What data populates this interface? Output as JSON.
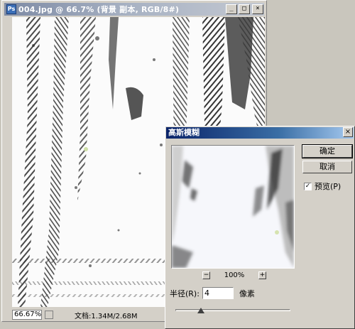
{
  "document": {
    "title": "004.jpg @ 66.7% (背景 副本, RGB/8#)",
    "app_icon": "Ps",
    "window_buttons": {
      "minimize": "_",
      "maximize": "□",
      "close": "×"
    },
    "zoom": "66.67%",
    "doc_info": "文档:1.34M/2.68M",
    "status_arrow": "▶"
  },
  "dialog": {
    "title": "高斯模糊",
    "close_glyph": "×",
    "ok_label": "确定",
    "cancel_label": "取消",
    "preview_label": "预览(P)",
    "preview_checked": "✓",
    "zoom_out": "−",
    "zoom_in": "+",
    "zoom_percent": "100%",
    "radius_label": "半径(R):",
    "radius_value": "4",
    "radius_unit": "像素",
    "slider_position": 0.22
  }
}
